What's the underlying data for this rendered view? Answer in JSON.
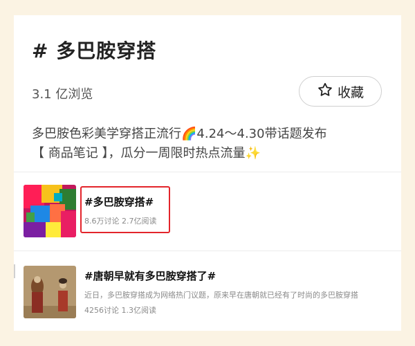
{
  "topic": {
    "title": "# 多巴胺穿搭",
    "views": "3.1 亿浏览",
    "favorite_label": "收藏",
    "description_line1": "多巴胺色彩美学穿搭正流行",
    "description_range": "4.24～4.30带话题发布",
    "description_line2": "【 商品笔记 】，瓜分一周限时热点流量"
  },
  "related": [
    {
      "title": "#多巴胺穿搭#",
      "meta": "8.6万讨论 2.7亿阅读",
      "highlighted": true
    },
    {
      "title": "#唐朝早就有多巴胺穿搭了#",
      "excerpt": "近日，多巴胺穿搭成为网络热门议题，原来早在唐朝就已经有了时尚的多巴胺穿搭",
      "meta": "4256讨论 1.3亿阅读",
      "highlighted": false
    }
  ],
  "colors": {
    "page_background": "#fbf3e3",
    "card_background": "#ffffff",
    "highlight_border": "#e3242b",
    "meta_text": "#8a8a8a"
  },
  "icons": [
    "star-outline-icon",
    "rainbow-emoji",
    "sparkles-emoji"
  ]
}
